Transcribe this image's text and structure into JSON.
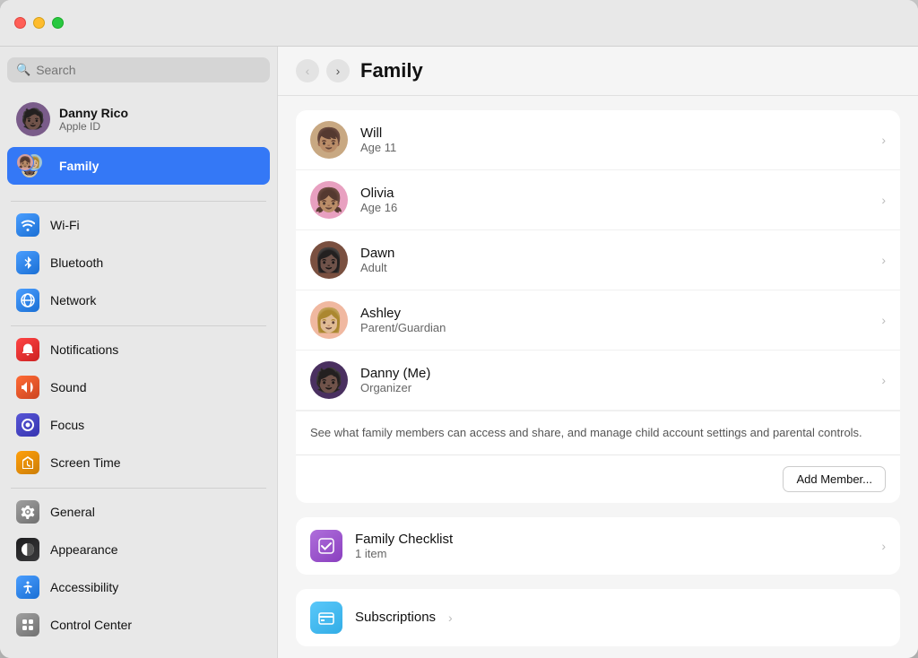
{
  "window": {
    "title": "Family"
  },
  "titlebar": {
    "traffic_lights": [
      "red",
      "yellow",
      "green"
    ]
  },
  "sidebar": {
    "search_placeholder": "Search",
    "user": {
      "name": "Danny Rico",
      "subtitle": "Apple ID",
      "avatar_emoji": "🧑🏿"
    },
    "family_item": {
      "label": "Family"
    },
    "items": [
      {
        "id": "wifi",
        "label": "Wi-Fi",
        "icon": "wifi",
        "icon_char": "📶"
      },
      {
        "id": "bluetooth",
        "label": "Bluetooth",
        "icon": "bluetooth",
        "icon_char": "🔵"
      },
      {
        "id": "network",
        "label": "Network",
        "icon": "network",
        "icon_char": "🌐"
      },
      {
        "id": "notifications",
        "label": "Notifications",
        "icon": "notifications",
        "icon_char": "🔔"
      },
      {
        "id": "sound",
        "label": "Sound",
        "icon": "sound",
        "icon_char": "🔊"
      },
      {
        "id": "focus",
        "label": "Focus",
        "icon": "focus",
        "icon_char": "🌙"
      },
      {
        "id": "screentime",
        "label": "Screen Time",
        "icon": "screentime",
        "icon_char": "⏳"
      },
      {
        "id": "general",
        "label": "General",
        "icon": "general",
        "icon_char": "⚙️"
      },
      {
        "id": "appearance",
        "label": "Appearance",
        "icon": "appearance",
        "icon_char": "🎨"
      },
      {
        "id": "accessibility",
        "label": "Accessibility",
        "icon": "accessibility",
        "icon_char": "♿"
      },
      {
        "id": "controlcenter",
        "label": "Control Center",
        "icon": "controlcenter",
        "icon_char": "🎛️"
      }
    ]
  },
  "main": {
    "title": "Family",
    "nav": {
      "back_label": "‹",
      "forward_label": "›"
    },
    "members": [
      {
        "id": "will",
        "name": "Will",
        "role": "Age 11",
        "emoji": "👦🏽"
      },
      {
        "id": "olivia",
        "name": "Olivia",
        "role": "Age 16",
        "emoji": "👧🏽"
      },
      {
        "id": "dawn",
        "name": "Dawn",
        "role": "Adult",
        "emoji": "👩🏿"
      },
      {
        "id": "ashley",
        "name": "Ashley",
        "role": "Parent/Guardian",
        "emoji": "👩🏼"
      },
      {
        "id": "danny",
        "name": "Danny (Me)",
        "role": "Organizer",
        "emoji": "🧑🏿"
      }
    ],
    "description": "See what family members can access and share, and manage child account settings and parental controls.",
    "add_member_label": "Add Member...",
    "checklist": {
      "name": "Family Checklist",
      "count": "1 item",
      "icon": "✓"
    },
    "subscriptions": {
      "name": "Subscriptions",
      "icon": "💳"
    }
  }
}
